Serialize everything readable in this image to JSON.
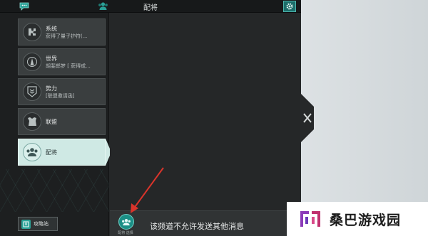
{
  "topbar": {
    "title": "配将",
    "icons": {
      "chat": "chat-bubble-icon",
      "people": "group-icon",
      "settings": "gear-icon"
    }
  },
  "channels": [
    {
      "name": "系统",
      "preview": "获得了量子护符(...",
      "icon": "puzzle-icon",
      "active": false
    },
    {
      "name": "世界",
      "preview": "胡斐郎梦 [ 获得成...",
      "icon": "globe-figure-icon",
      "active": false
    },
    {
      "name": "势力",
      "preview": "[联盟邀请函]",
      "icon": "shield-rank-icon",
      "active": false
    },
    {
      "name": "联盟",
      "preview": "",
      "icon": "armor-icon",
      "active": false
    },
    {
      "name": "配将",
      "preview": "",
      "icon": "team-icon",
      "active": true
    }
  ],
  "guide_button": {
    "label": "攻略站",
    "icon": "book-icon"
  },
  "bottombar": {
    "icon_label": "配将 选择",
    "notice": "该频道不允许发送其他消息"
  },
  "watermark": {
    "text": "桑巴游戏园",
    "icon": "sangba-logo"
  },
  "colors": {
    "accent": "#1c6e6a",
    "active_tab": "#cfe9e4",
    "panel_bg": "#262829",
    "arrow": "#d9342b"
  }
}
